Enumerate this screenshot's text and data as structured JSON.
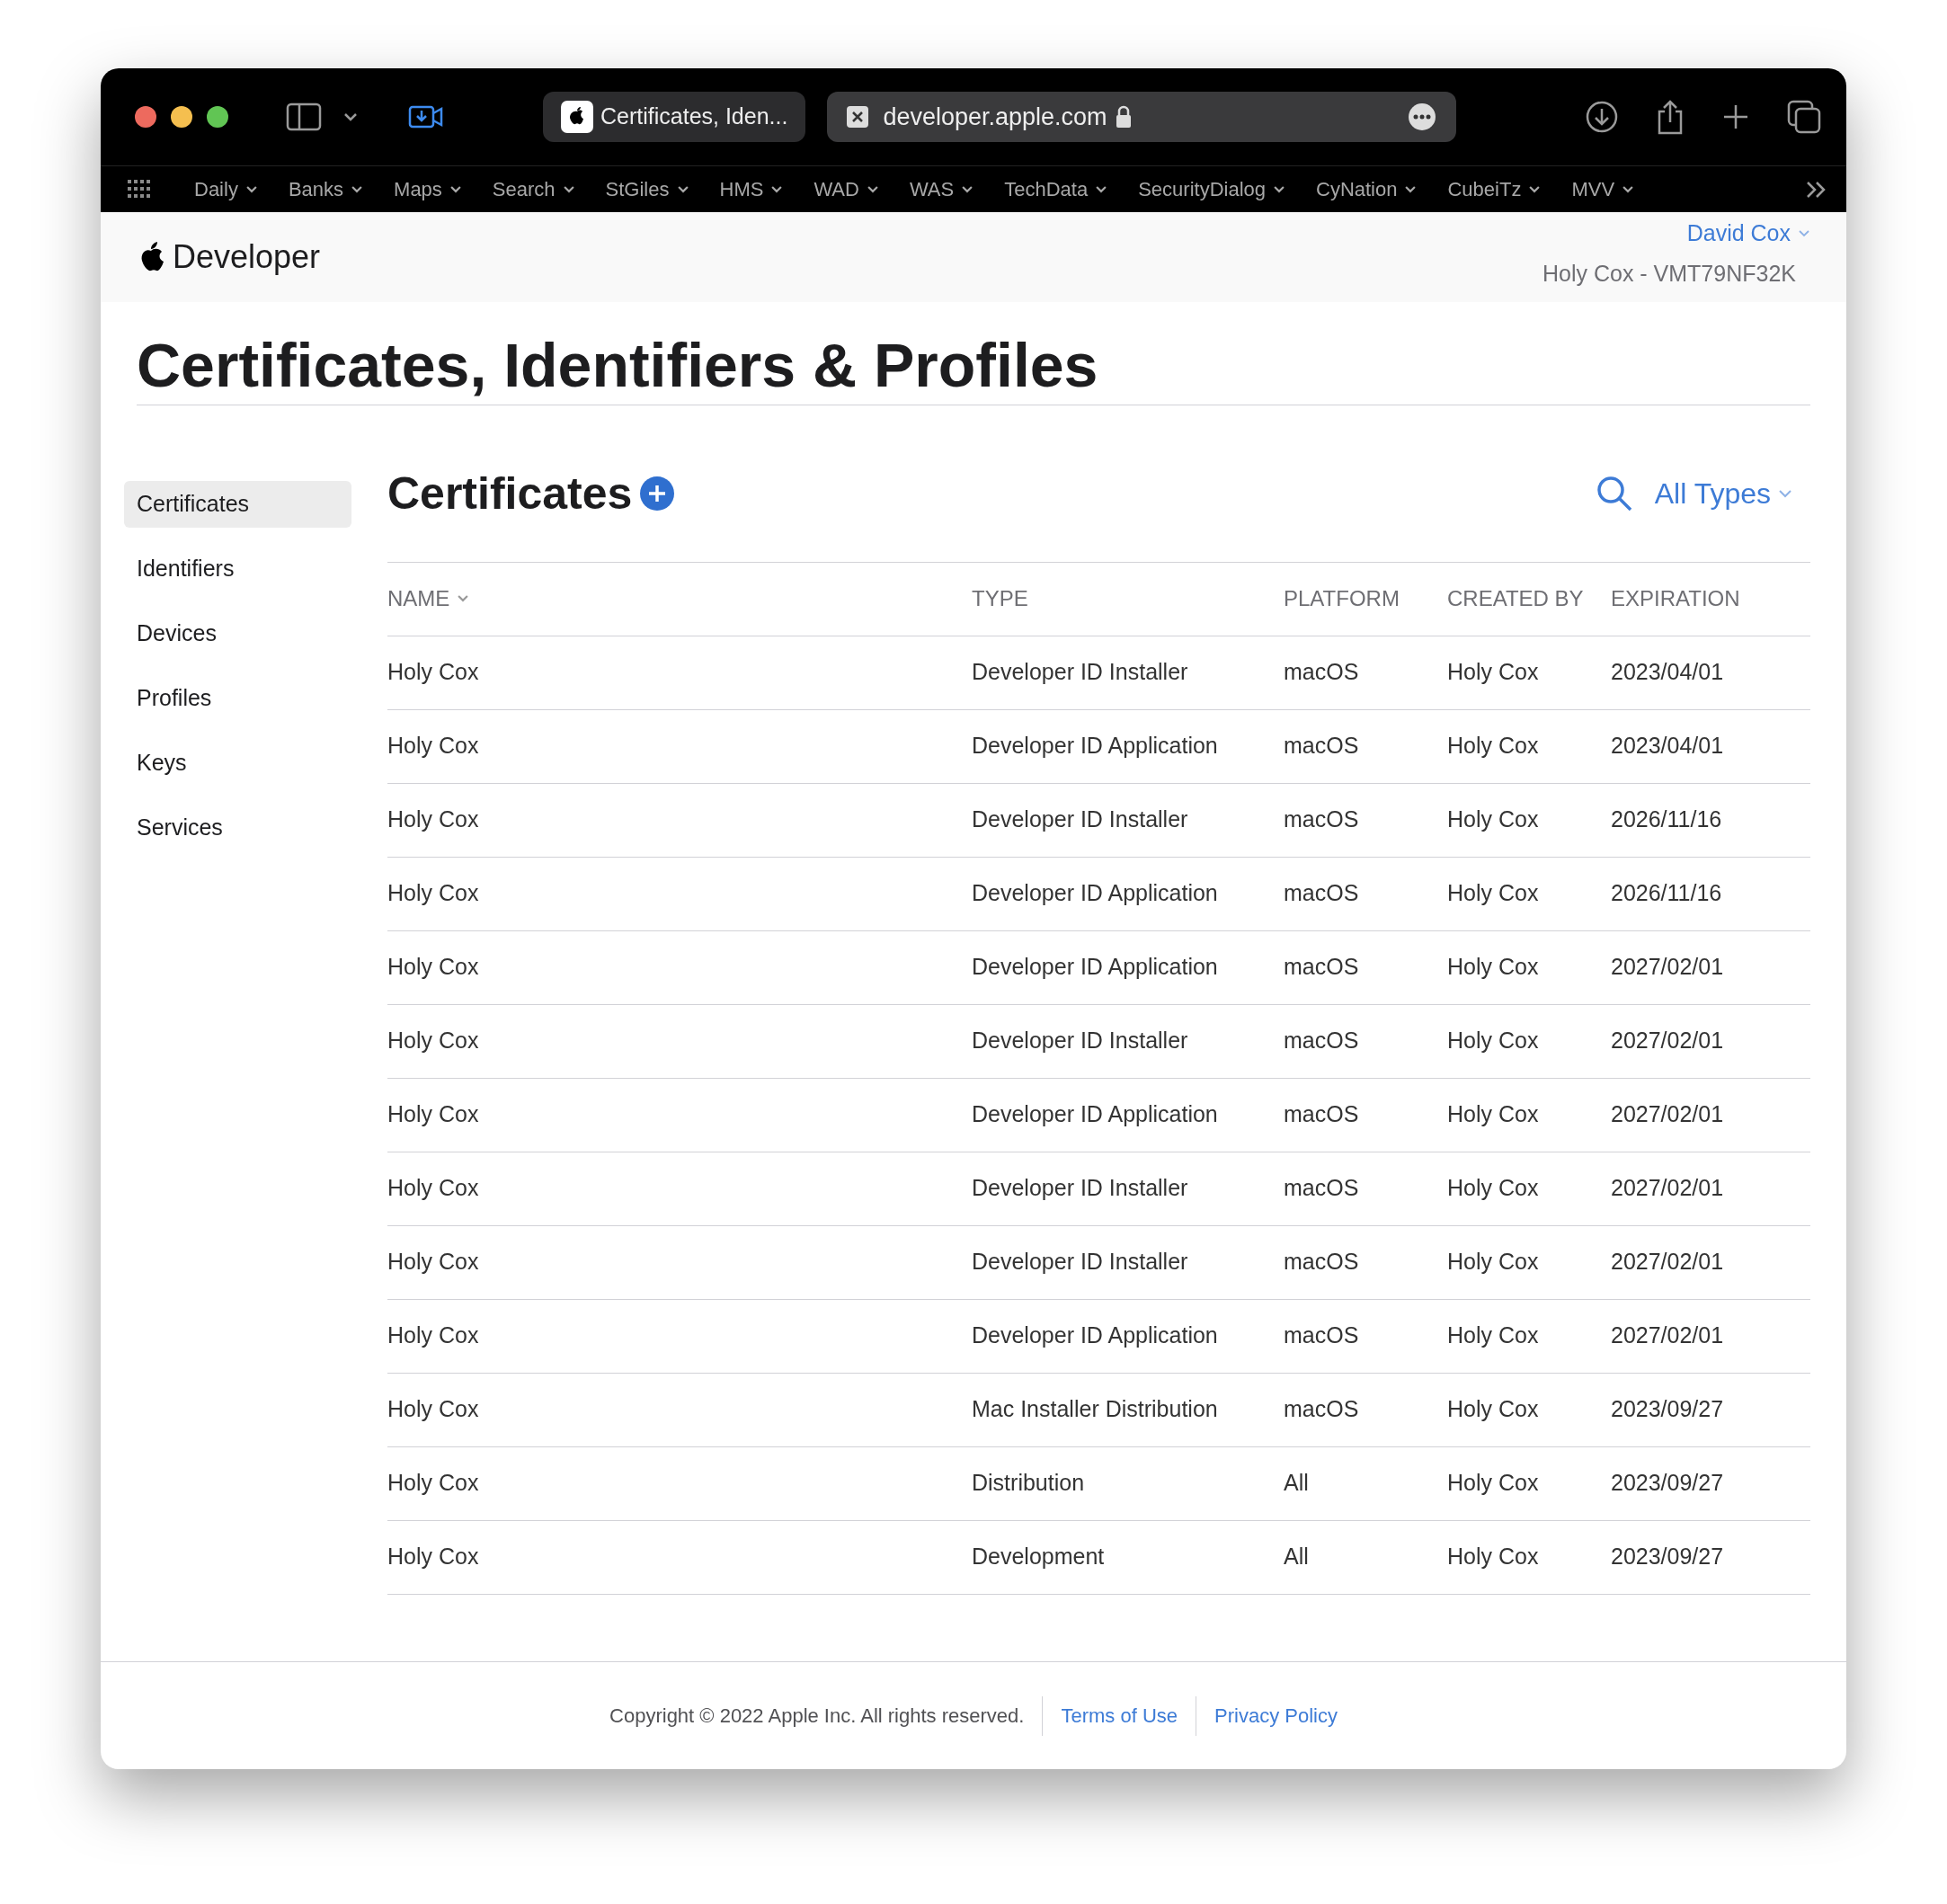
{
  "browser": {
    "tab_title": "Certificates, Iden...",
    "url": "developer.apple.com",
    "bookmarks": [
      "Daily",
      "Banks",
      "Maps",
      "Search",
      "StGiles",
      "HMS",
      "WAD",
      "WAS",
      "TechData",
      "SecurityDialog",
      "CyNation",
      "CubeiTz",
      "MVV"
    ]
  },
  "header": {
    "logo_text": "Developer",
    "user": "David Cox",
    "team": "Holy Cox - VMT79NF32K"
  },
  "page_title": "Certificates, Identifiers & Profiles",
  "sidebar": {
    "items": [
      {
        "label": "Certificates",
        "selected": true
      },
      {
        "label": "Identifiers",
        "selected": false
      },
      {
        "label": "Devices",
        "selected": false
      },
      {
        "label": "Profiles",
        "selected": false
      },
      {
        "label": "Keys",
        "selected": false
      },
      {
        "label": "Services",
        "selected": false
      }
    ]
  },
  "section": {
    "title": "Certificates",
    "filter": "All Types"
  },
  "table": {
    "columns": [
      {
        "label": "NAME",
        "sorted": true
      },
      {
        "label": "TYPE",
        "sorted": false
      },
      {
        "label": "PLATFORM",
        "sorted": false
      },
      {
        "label": "CREATED BY",
        "sorted": false
      },
      {
        "label": "EXPIRATION",
        "sorted": false
      }
    ],
    "rows": [
      [
        "Holy Cox",
        "Developer ID Installer",
        "macOS",
        "Holy Cox",
        "2023/04/01"
      ],
      [
        "Holy Cox",
        "Developer ID Application",
        "macOS",
        "Holy Cox",
        "2023/04/01"
      ],
      [
        "Holy Cox",
        "Developer ID Installer",
        "macOS",
        "Holy Cox",
        "2026/11/16"
      ],
      [
        "Holy Cox",
        "Developer ID Application",
        "macOS",
        "Holy Cox",
        "2026/11/16"
      ],
      [
        "Holy Cox",
        "Developer ID Application",
        "macOS",
        "Holy Cox",
        "2027/02/01"
      ],
      [
        "Holy Cox",
        "Developer ID Installer",
        "macOS",
        "Holy Cox",
        "2027/02/01"
      ],
      [
        "Holy Cox",
        "Developer ID Application",
        "macOS",
        "Holy Cox",
        "2027/02/01"
      ],
      [
        "Holy Cox",
        "Developer ID Installer",
        "macOS",
        "Holy Cox",
        "2027/02/01"
      ],
      [
        "Holy Cox",
        "Developer ID Installer",
        "macOS",
        "Holy Cox",
        "2027/02/01"
      ],
      [
        "Holy Cox",
        "Developer ID Application",
        "macOS",
        "Holy Cox",
        "2027/02/01"
      ],
      [
        "Holy Cox",
        "Mac Installer Distribution",
        "macOS",
        "Holy Cox",
        "2023/09/27"
      ],
      [
        "Holy Cox",
        "Distribution",
        "All",
        "Holy Cox",
        "2023/09/27"
      ],
      [
        "Holy Cox",
        "Development",
        "All",
        "Holy Cox",
        "2023/09/27"
      ]
    ]
  },
  "footer": {
    "copyright": "Copyright © 2022 Apple Inc. All rights reserved.",
    "links": [
      "Terms of Use",
      "Privacy Policy"
    ]
  }
}
